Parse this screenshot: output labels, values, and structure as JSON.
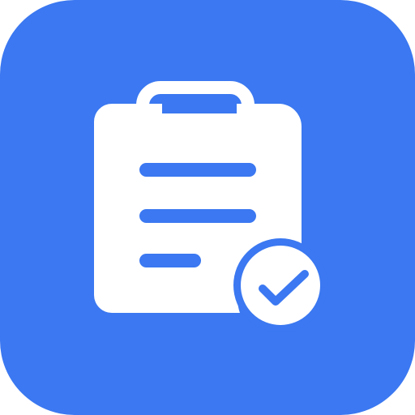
{
  "app_icon": {
    "icon_name": "clipboard-check-icon",
    "colors": {
      "tile_background": "#3b78f1",
      "glyph": "#ffffff",
      "check_stroke": "#3b78f1"
    }
  }
}
